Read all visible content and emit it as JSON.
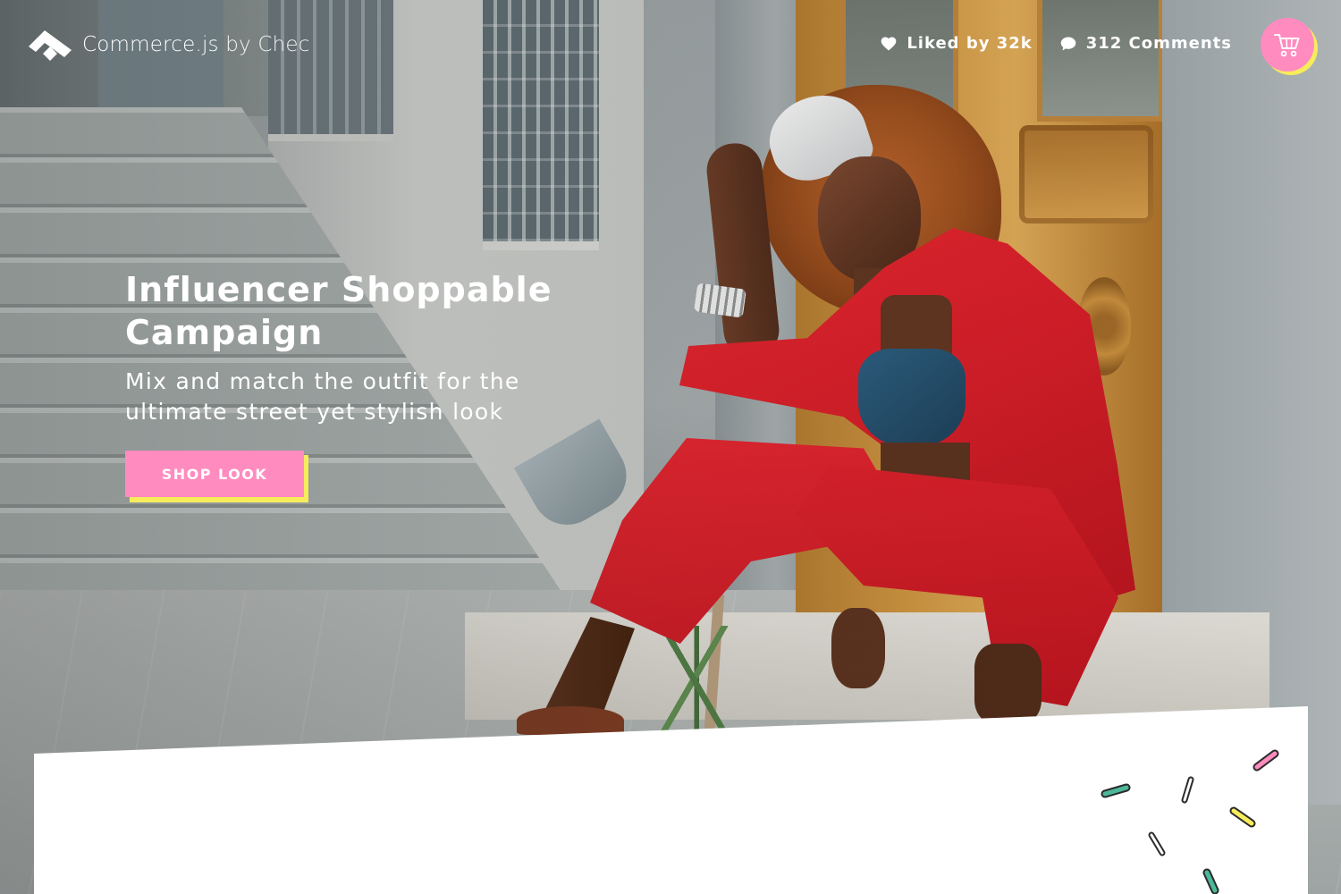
{
  "brand": {
    "name": "Commerce.js",
    "by_text": "by Chec",
    "logo_icon": "chec-logo-icon"
  },
  "header": {
    "likes_label": "Liked by 32k",
    "likes_icon": "heart-icon",
    "comments_label": "312 Comments",
    "comments_icon": "comment-bubble-icon",
    "cart_icon": "shopping-cart-icon"
  },
  "hero": {
    "title": "Influencer Shoppable Campaign",
    "subtitle": "Mix and match the outfit for the ultimate street yet stylish look",
    "cta_label": "SHOP LOOK"
  },
  "colors": {
    "accent_pink": "#ff8bbf",
    "accent_yellow": "#f7ec5b",
    "text_white": "#ffffff",
    "card_white": "#ffffff",
    "sprinkle_teal": "#4cb89a",
    "sprinkle_pink": "#ff8bbf",
    "sprinkle_yellow": "#f7ec5b",
    "sprinkle_outline": "#2b2b2b"
  }
}
